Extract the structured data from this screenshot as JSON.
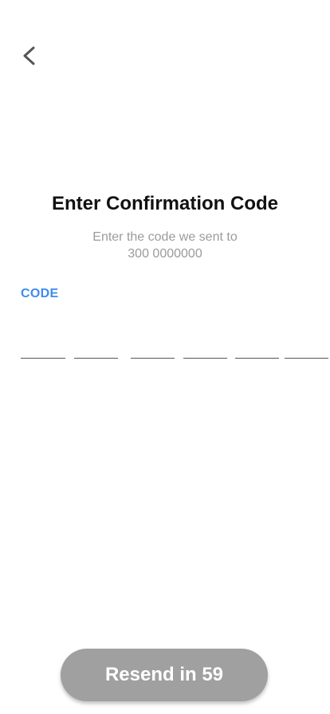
{
  "header": {
    "back_icon": "chevron-left-icon"
  },
  "verify": {
    "title": "Enter Confirmation Code",
    "instruction": "Enter the code we sent to",
    "phone_number": "300 0000000",
    "code_label": "CODE",
    "code_length": 6,
    "code_values": [
      "",
      "",
      "",
      "",
      "",
      ""
    ]
  },
  "resend": {
    "label": "Resend in 59"
  },
  "colors": {
    "accent": "#3c8cf0",
    "muted_text": "#9b9b9b",
    "button_disabled": "#a0a0a0"
  }
}
